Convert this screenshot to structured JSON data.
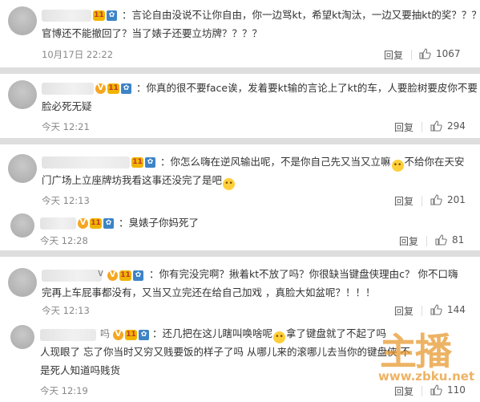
{
  "comments": [
    {
      "text_lines": [
        "：言论自由没说不让你自由，你一边骂kt，希望kt淘汰，一边又要抽kt的奖？？？",
        "官博还不能撤回了？当了婊子还要立坊牌？？？？"
      ],
      "time": "10月17日 22:22",
      "reply_label": "回复",
      "likes": "1067"
    },
    {
      "text_lines": [
        "：你真的很不要face诶，发着要kt输的言论上了kt的车，人要脸树要皮你不要",
        "脸必死无疑"
      ],
      "time": "今天 12:21",
      "reply_label": "回复",
      "likes": "294"
    },
    {
      "text_lines": [
        "：你怎么嗨在逆风输出呢，不是你自己先又当又立嘛",
        "不给你在天安",
        "门广场上立座牌坊我看这事还没完了是吧"
      ],
      "time": "今天 12:13",
      "reply_label": "回复",
      "likes": "201"
    },
    {
      "text_lines": [
        "：臭婊子你妈死了"
      ],
      "time": "今天 12:28",
      "reply_label": "回复",
      "likes": "81"
    },
    {
      "text_lines": [
        "：你有完没完啊？揪着kt不放了吗？你很缺当键盘侠理由c？ 你不口嗨",
        "完再上车屁事都没有，又当又立完还在给自己加戏 ，真脸大如盆呢？！！！"
      ],
      "time": "今天 12:13",
      "reply_label": "回复",
      "likes": "144"
    },
    {
      "text_lines": [
        "：还几把在这儿瞎叫唤啥呢",
        "拿了键盘就了不起了吗",
        "人现眼了 忘了你当时又穷又贱要饭的样子了吗 从哪儿来的滚哪儿去当你的键盘侠 不",
        "是死人知道吗贱货"
      ],
      "time": "今天 12:19",
      "reply_label": "回复",
      "likes": "110"
    }
  ],
  "name_fragments": {
    "c5": "v",
    "c6": "吗"
  },
  "badge_glyphs": {
    "v": "V",
    "level": "11",
    "fan": "✿"
  },
  "emoji_glyph": "••",
  "watermark": {
    "title": "主播",
    "url": "www.zbku.net"
  },
  "colors": {
    "page_bg": "#dedede",
    "card_bg": "#ffffff",
    "vip_badge": "#f5a623",
    "watermark": "#e89628"
  }
}
